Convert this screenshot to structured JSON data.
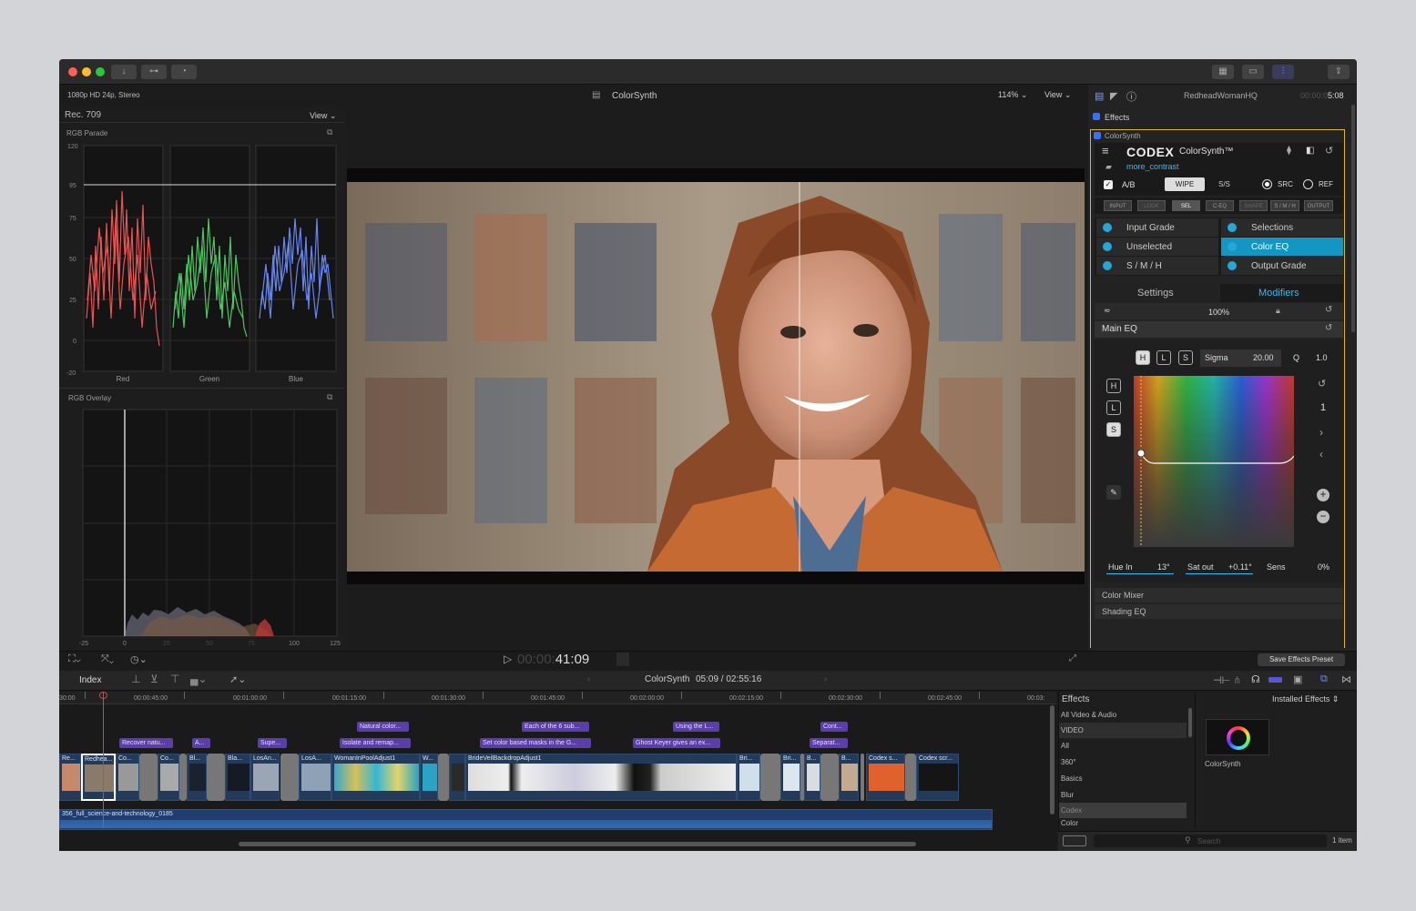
{
  "toolbar": {
    "back_icon": "download-icon",
    "key_icon": "key-icon",
    "bg_icon": "background-tasks-icon"
  },
  "viewer": {
    "format": "1080p HD 24p, Stereo",
    "title": "ColorSynth",
    "zoom": "114%",
    "view": "View"
  },
  "scopes": {
    "colorspace": "Rec. 709",
    "view": "View",
    "parade_title": "RGB Parade",
    "parade_y_ticks": [
      "120",
      "95",
      "75",
      "50",
      "25",
      "0",
      "-20"
    ],
    "parade_channels": [
      "Red",
      "Green",
      "Blue"
    ],
    "overlay_title": "RGB Overlay",
    "overlay_x_ticks": [
      "-25",
      "0",
      "25",
      "50",
      "75",
      "100",
      "125"
    ]
  },
  "inspector": {
    "clip_name": "RedheadWomanHQ",
    "duration_dim": "00:00:0",
    "duration": "5:08",
    "effects_label": "Effects",
    "plugin_name": "ColorSynth",
    "brand": "CODEX",
    "product": "ColorSynth™",
    "preset": "more_contrast",
    "ab_label": "A/B",
    "wipe": "WIPE",
    "ss": "S/S",
    "src": "SRC",
    "ref": "REF",
    "stage_tabs": [
      "INPUT",
      "LOOK",
      "SEL",
      "C-EQ",
      "SHAPE",
      "S / M / H",
      "OUTPUT"
    ],
    "grade_left": [
      "Input Grade",
      "Unselected",
      "S / M / H"
    ],
    "grade_right": [
      "Selections",
      "Color EQ",
      "Output Grade"
    ],
    "tab_settings": "Settings",
    "tab_modifiers": "Modifiers",
    "opacity": "100%",
    "main_eq": "Main EQ",
    "hls": [
      "H",
      "L",
      "S"
    ],
    "sigma_label": "Sigma",
    "sigma_value": "20.00",
    "q_label": "Q",
    "q_value": "1.0",
    "page_num": "1",
    "hue_in_label": "Hue In",
    "hue_in_value": "13°",
    "sat_out_label": "Sat out",
    "sat_out_value": "+0.11°",
    "sens_label": "Sens",
    "sens_value": "0%",
    "color_mixer": "Color Mixer",
    "shading_eq": "Shading EQ",
    "save_preset": "Save Effects Preset"
  },
  "transport": {
    "timecode_dim": "00:00:",
    "timecode": "41:09"
  },
  "timeline": {
    "index": "Index",
    "project": "ColorSynth",
    "position": "05:09 / 02:55:16",
    "ruler": [
      "30:00",
      "00:00:45:00",
      "00:01:00:00",
      "00:01:15:00",
      "00:01:30:00",
      "00:01:45:00",
      "00:02:00:00",
      "00:02:15:00",
      "00:02:30:00",
      "00:02:45:00",
      "00:03:"
    ],
    "upper_titles": [
      "Natural color...",
      "Each of the 6 sub...",
      "Using the L...",
      "Cont..."
    ],
    "lower_titles": [
      "Recover natu...",
      "A...",
      "Supe...",
      "Isolate and remap...",
      "Set color based masks in the G...",
      "Ghost Keyer gives an ex...",
      "Separat..."
    ],
    "clips": [
      "Re...",
      "Redhea...",
      "Co...",
      "Co...",
      "Bl...",
      "Bla...",
      "LosAn...",
      "LosA...",
      "WomanInPoolAdjust1",
      "W...",
      "BrideVeilBackdropAdjust1",
      "Bri...",
      "Bri...",
      "B...",
      "B...",
      "Codex s...",
      "Codex scr..."
    ],
    "audio": "356_full_science-and-technology_0185"
  },
  "effects_browser": {
    "title": "Effects",
    "installed": "Installed Effects",
    "categories": [
      "All Video & Audio",
      "VIDEO",
      "All",
      "360°",
      "Basics",
      "Blur",
      "Codex",
      "Color"
    ],
    "effect_name": "ColorSynth",
    "search_placeholder": "Search",
    "count": "1 item"
  }
}
